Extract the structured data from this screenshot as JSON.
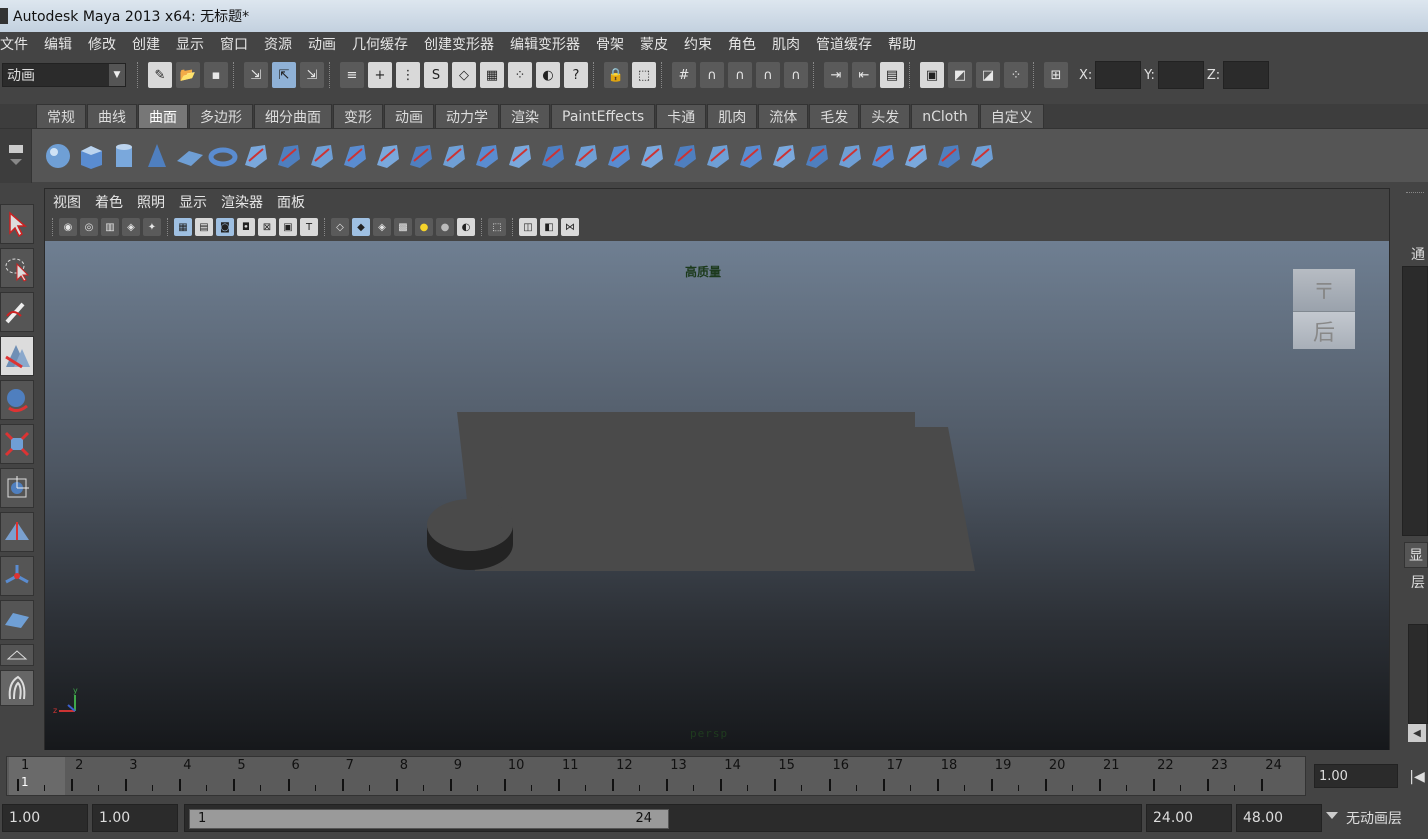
{
  "window": {
    "title": "Autodesk Maya 2013 x64: 无标题*"
  },
  "menubar": [
    "文件",
    "编辑",
    "修改",
    "创建",
    "显示",
    "窗口",
    "资源",
    "动画",
    "几何缓存",
    "创建变形器",
    "编辑变形器",
    "骨架",
    "蒙皮",
    "约束",
    "角色",
    "肌肉",
    "管道缓存",
    "帮助"
  ],
  "statusline": {
    "mode": "动画",
    "coords": {
      "x_label": "X:",
      "y_label": "Y:",
      "z_label": "Z:",
      "x": "",
      "y": "",
      "z": ""
    }
  },
  "shelf": {
    "tabs": [
      "常规",
      "曲线",
      "曲面",
      "多边形",
      "细分曲面",
      "变形",
      "动画",
      "动力学",
      "渲染",
      "PaintEffects",
      "卡通",
      "肌肉",
      "流体",
      "毛发",
      "头发",
      "nCloth",
      "自定义"
    ],
    "active_tab": "曲面",
    "icons": [
      "nurbs-sphere-icon",
      "nurbs-cube-icon",
      "nurbs-cylinder-icon",
      "nurbs-cone-icon",
      "nurbs-plane-icon",
      "nurbs-torus-icon",
      "revolve-icon",
      "loft-icon",
      "planar-icon",
      "extrude-icon",
      "birail-icon",
      "boundary-icon",
      "square-icon",
      "bevel-icon",
      "project-curve-icon",
      "intersect-icon",
      "trim-icon",
      "untrim-icon",
      "attach-icon",
      "detach-icon",
      "align-icon",
      "open-close-icon",
      "insert-isoparm-icon",
      "extend-icon",
      "offset-icon",
      "rebuild-icon",
      "reverse-icon",
      "sculpt-icon",
      "surface-edit-icon"
    ]
  },
  "panel": {
    "menu": [
      "视图",
      "着色",
      "照明",
      "显示",
      "渲染器",
      "面板"
    ],
    "quality_label": "高质量",
    "camera_label": "persp",
    "viewcube": {
      "top": "〒",
      "front": "后"
    }
  },
  "right_panel": {
    "top_label": "通",
    "tab_label": "显",
    "layer_label": "层"
  },
  "timeline": {
    "ticks": [
      1,
      2,
      3,
      4,
      5,
      6,
      7,
      8,
      9,
      10,
      11,
      12,
      13,
      14,
      15,
      16,
      17,
      18,
      19,
      20,
      21,
      22,
      23,
      24
    ],
    "current_frame_marker": "1",
    "current_frame": "1.00"
  },
  "range": {
    "start": "1.00",
    "playback_start": "1.00",
    "handle_start": "1",
    "handle_end": "24",
    "playback_end": "24.00",
    "end": "48.00",
    "anim_layer": "无动画层"
  },
  "colors": {
    "bg": "#444444",
    "viewport_top": "#6f7f92",
    "viewport_bottom": "#16181b",
    "accent_blue": "#8fb1d6"
  }
}
